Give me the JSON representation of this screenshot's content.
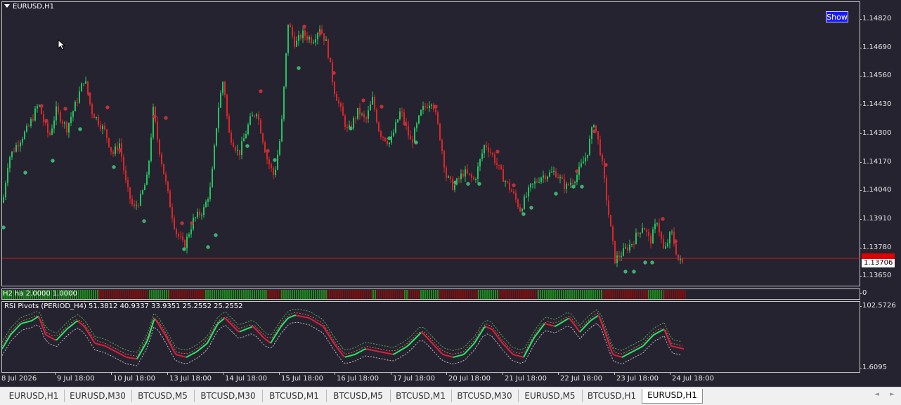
{
  "chart": {
    "title": "EURUSD,H1",
    "show_button": "Show",
    "price_ticks": [
      "1.14820",
      "1.14690",
      "1.14560",
      "1.14430",
      "1.14300",
      "1.14170",
      "1.14040",
      "1.13910",
      "1.13780",
      "1.13650"
    ],
    "current_price": "1.13706",
    "price_line_level": 1.13706,
    "price_range": [
      1.1358,
      1.1487
    ],
    "date_labels": [
      "8 Jul 2026",
      "9 Jul 18:00",
      "10 Jul 18:00",
      "13 Jul 18:00",
      "14 Jul 18:00",
      "15 Jul 18:00",
      "16 Jul 18:00",
      "17 Jul 18:00",
      "20 Jul 18:00",
      "21 Jul 18:00",
      "22 Jul 18:00",
      "23 Jul 18:00",
      "24 Jul 18:00"
    ],
    "colors": {
      "background": "#262330",
      "bull": "#22c55e",
      "bear": "#dc2626",
      "price_line": "#c81e1e",
      "buy_marker": "#3cb371",
      "sell_marker": "#c0303a"
    }
  },
  "indicator1": {
    "label": "H2  ha  2.0000 1.0000",
    "axis_value": "0"
  },
  "indicator2": {
    "label": "RSI Pivots (PERIOD_H4) 51.3812 40.9337 33.9351 25.2552 25.2552",
    "axis_top": "102.5726",
    "axis_bottom": "1.6095"
  },
  "tabs": [
    "EURUSD,H1",
    "EURUSD,M30",
    "BTCUSD,M5",
    "BTCUSD,M30",
    "BTCUSD,M1",
    "BTCUSD,M5",
    "BTCUSD,M1",
    "BTCUSD,M30",
    "EURUSD,M5",
    "BTCUSD,H1",
    "EURUSD,H1"
  ],
  "active_tab": 10,
  "tab_scroll": {
    "left": "◄",
    "right": "►"
  }
}
